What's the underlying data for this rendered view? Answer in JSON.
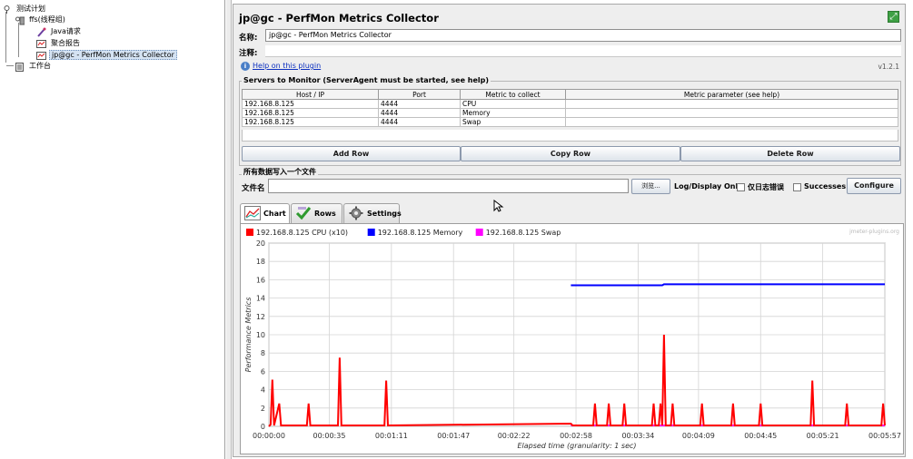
{
  "tree": {
    "root": "测试计划",
    "thread_group": "ffs(线程组)",
    "java_request": "Java请求",
    "aggregate_report": "聚合报告",
    "perfmon": "jp@gc - PerfMon Metrics Collector",
    "workbench": "工作台"
  },
  "panel": {
    "title": "jp@gc - PerfMon Metrics Collector",
    "name_label": "名称:",
    "name_value": "jp@gc - PerfMon Metrics Collector",
    "comment_label": "注释:",
    "help_link": "Help on this plugin",
    "version": "v1.2.1"
  },
  "servers": {
    "legend": "Servers to Monitor (ServerAgent must be started, see help)",
    "columns": [
      "Host / IP",
      "Port",
      "Metric to collect",
      "Metric parameter (see help)"
    ],
    "rows": [
      [
        "192.168.8.125",
        "4444",
        "CPU",
        ""
      ],
      [
        "192.168.8.125",
        "4444",
        "Memory",
        ""
      ],
      [
        "192.168.8.125",
        "4444",
        "Swap",
        ""
      ]
    ],
    "add_row": "Add Row",
    "copy_row": "Copy Row",
    "delete_row": "Delete Row"
  },
  "file": {
    "legend": "所有数据写入一个文件",
    "label": "文件名",
    "value": "",
    "browse": "浏览...",
    "log_display": "Log/Display Only:",
    "errors_only": "仅日志错误",
    "successes": "Successes",
    "configure": "Configure"
  },
  "tabs": [
    {
      "label": "Chart",
      "active": true
    },
    {
      "label": "Rows",
      "active": false
    },
    {
      "label": "Settings",
      "active": false
    }
  ],
  "chart_data": {
    "type": "line",
    "watermark": "jmeter-plugins.org",
    "xlabel": "Elapsed time (granularity: 1 sec)",
    "ylabel": "Performance Metrics",
    "ylim": [
      0,
      20
    ],
    "xlim": [
      0,
      357
    ],
    "yticks": [
      0,
      2,
      4,
      6,
      8,
      10,
      12,
      14,
      16,
      18,
      20
    ],
    "xticks": [
      {
        "v": 0,
        "label": "00:00:00"
      },
      {
        "v": 35,
        "label": "00:00:35"
      },
      {
        "v": 71,
        "label": "00:01:11"
      },
      {
        "v": 107,
        "label": "00:01:47"
      },
      {
        "v": 142,
        "label": "00:02:22"
      },
      {
        "v": 178,
        "label": "00:02:58"
      },
      {
        "v": 214,
        "label": "00:03:34"
      },
      {
        "v": 249,
        "label": "00:04:09"
      },
      {
        "v": 285,
        "label": "00:04:45"
      },
      {
        "v": 321,
        "label": "00:05:21"
      },
      {
        "v": 357,
        "label": "00:05:57"
      }
    ],
    "grid": true,
    "legend_position": "top-left",
    "series": [
      {
        "name": "192.168.8.125 CPU (x10)",
        "color": "#ff0000",
        "points": [
          [
            0,
            0
          ],
          [
            1,
            0.2
          ],
          [
            2,
            5.1
          ],
          [
            3,
            0.1
          ],
          [
            6,
            2.5
          ],
          [
            7,
            0.1
          ],
          [
            22,
            0.1
          ],
          [
            23,
            2.5
          ],
          [
            24,
            0.1
          ],
          [
            40,
            0.1
          ],
          [
            41,
            7.5
          ],
          [
            42,
            0.1
          ],
          [
            67,
            0.1
          ],
          [
            68,
            5.0
          ],
          [
            69,
            0.1
          ],
          [
            175,
            0.3
          ],
          [
            176,
            0.1
          ],
          [
            188,
            0.1
          ],
          [
            189,
            2.5
          ],
          [
            190,
            0.1
          ],
          [
            196,
            0.1
          ],
          [
            197,
            2.5
          ],
          [
            198,
            0.1
          ],
          [
            205,
            0.1
          ],
          [
            206,
            2.5
          ],
          [
            207,
            0.1
          ],
          [
            222,
            0.1
          ],
          [
            223,
            2.5
          ],
          [
            224,
            0.1
          ],
          [
            226,
            0.1
          ],
          [
            227,
            2.5
          ],
          [
            228,
            0.1
          ],
          [
            229,
            10.0
          ],
          [
            230,
            0.1
          ],
          [
            233,
            0.1
          ],
          [
            234,
            2.5
          ],
          [
            235,
            0.1
          ],
          [
            250,
            0.1
          ],
          [
            251,
            2.5
          ],
          [
            252,
            0.1
          ],
          [
            268,
            0.1
          ],
          [
            269,
            2.5
          ],
          [
            270,
            0.1
          ],
          [
            284,
            0.1
          ],
          [
            285,
            2.5
          ],
          [
            286,
            0.1
          ],
          [
            314,
            0.1
          ],
          [
            315,
            5.0
          ],
          [
            316,
            0.1
          ],
          [
            334,
            0.1
          ],
          [
            335,
            2.5
          ],
          [
            336,
            0.1
          ],
          [
            355,
            0.1
          ],
          [
            356,
            2.5
          ],
          [
            357,
            0.1
          ]
        ]
      },
      {
        "name": "192.168.8.125 Memory",
        "color": "#0000ff",
        "points": [
          [
            175,
            15.4
          ],
          [
            228,
            15.4
          ],
          [
            229,
            15.5
          ],
          [
            357,
            15.5
          ]
        ]
      },
      {
        "name": "192.168.8.125 Swap",
        "color": "#ff00ff",
        "points": [
          [
            175,
            0.1
          ],
          [
            357,
            0.1
          ]
        ]
      }
    ]
  }
}
